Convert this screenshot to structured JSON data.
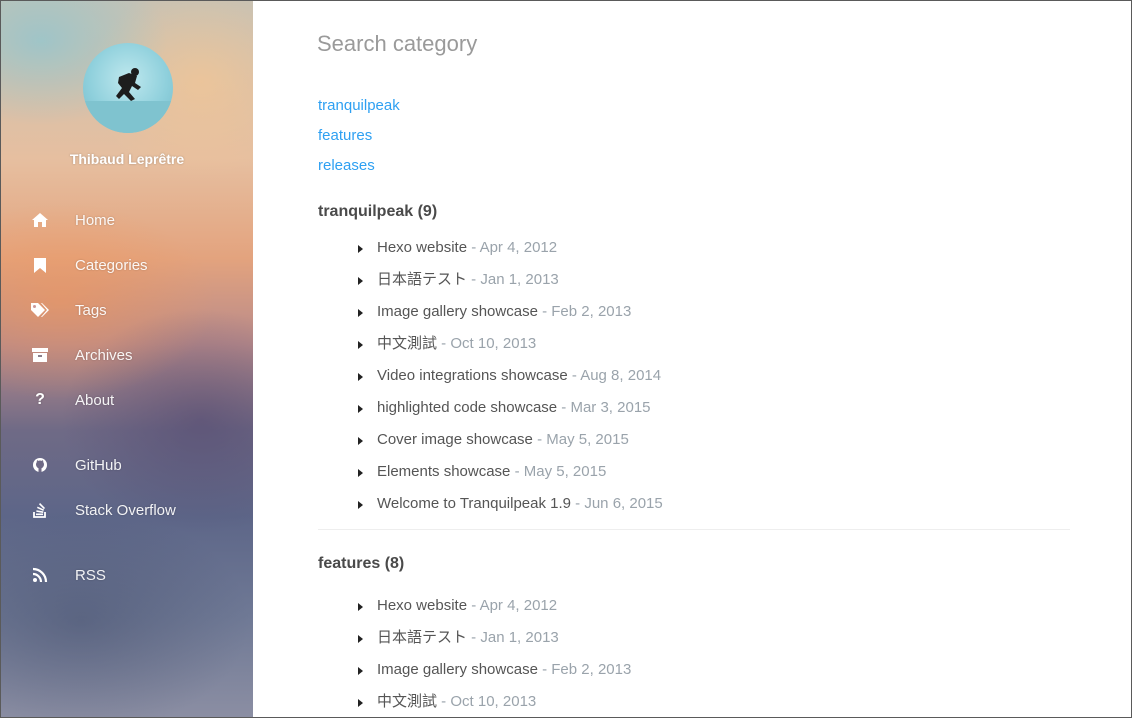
{
  "sidebar": {
    "author": "Thibaud Leprêtre",
    "nav": [
      {
        "label": "Home",
        "icon": "home-icon"
      },
      {
        "label": "Categories",
        "icon": "bookmark-icon"
      },
      {
        "label": "Tags",
        "icon": "tags-icon"
      },
      {
        "label": "Archives",
        "icon": "archive-icon"
      },
      {
        "label": "About",
        "icon": "question-icon"
      },
      {
        "label": "GitHub",
        "icon": "github-icon"
      },
      {
        "label": "Stack Overflow",
        "icon": "stackoverflow-icon"
      },
      {
        "label": "RSS",
        "icon": "rss-icon"
      }
    ]
  },
  "main": {
    "search_placeholder": "Search category",
    "category_links": [
      "tranquilpeak",
      "features",
      "releases"
    ],
    "sections": [
      {
        "name": "tranquilpeak",
        "count": "(9)",
        "posts": [
          {
            "title": "Hexo website",
            "date": "Apr 4, 2012"
          },
          {
            "title": "日本語テスト",
            "date": "Jan 1, 2013"
          },
          {
            "title": "Image gallery showcase",
            "date": "Feb 2, 2013"
          },
          {
            "title": "中文測試",
            "date": "Oct 10, 2013"
          },
          {
            "title": "Video integrations showcase",
            "date": "Aug 8, 2014"
          },
          {
            "title": "highlighted code showcase",
            "date": "Mar 3, 2015"
          },
          {
            "title": "Cover image showcase",
            "date": "May 5, 2015"
          },
          {
            "title": "Elements showcase",
            "date": "May 5, 2015"
          },
          {
            "title": "Welcome to Tranquilpeak 1.9",
            "date": "Jun 6, 2015"
          }
        ]
      },
      {
        "name": "features",
        "count": "(8)",
        "posts": [
          {
            "title": "Hexo website",
            "date": "Apr 4, 2012"
          },
          {
            "title": "日本語テスト",
            "date": "Jan 1, 2013"
          },
          {
            "title": "Image gallery showcase",
            "date": "Feb 2, 2013"
          },
          {
            "title": "中文測試",
            "date": "Oct 10, 2013"
          }
        ]
      }
    ],
    "date_separator": " - ",
    "colors": {
      "link": "#2ea0f2",
      "date": "#9aa3ab",
      "text": "#555555"
    }
  }
}
